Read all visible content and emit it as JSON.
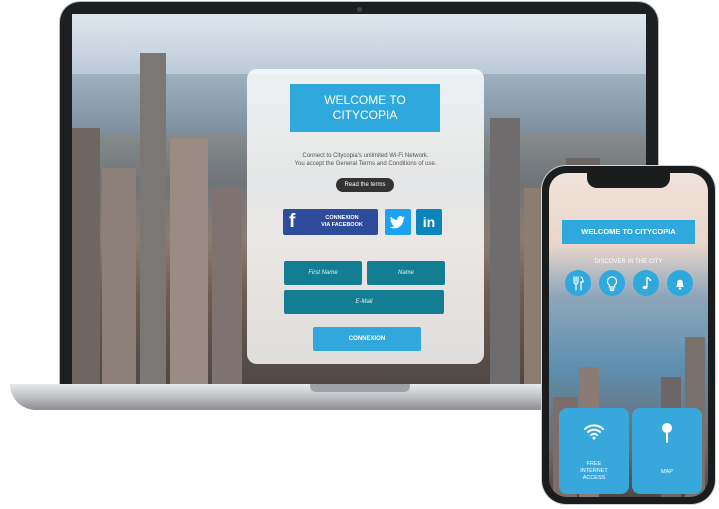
{
  "desktop": {
    "welcome_line1": "WELCOME TO",
    "welcome_line2": "CITYCOPIA",
    "intro_line1": "Connect to Citycopia's unlimited Wi-Fi Network.",
    "intro_line2": "You accept the General Terms and Conditions of use.",
    "read_terms": "Read the terms",
    "facebook_line1": "CONNEXION",
    "facebook_line2": "VIA FACEBOOK",
    "linkedin_label": "in",
    "first_name_placeholder": "First Name",
    "name_placeholder": "Name",
    "email_placeholder": "E-Mail",
    "connect_button": "CONNEXION"
  },
  "mobile": {
    "welcome": "WELCOME TO CITYCOPIA",
    "discover": "DISCOVER IN THE CITY",
    "icons": [
      "fork-knife-icon",
      "lightbulb-icon",
      "music-note-icon",
      "bell-icon"
    ],
    "tile_wifi_line1": "FREE",
    "tile_wifi_line2": "INTERNET",
    "tile_wifi_line3": "ACCESS",
    "tile_map": "MAP"
  },
  "colors": {
    "accent_blue": "#2fa8de",
    "facebook_blue": "#2f4b9b",
    "twitter_blue": "#1da1f2",
    "linkedin_blue": "#0a84bd",
    "field_teal": "#137d94"
  }
}
